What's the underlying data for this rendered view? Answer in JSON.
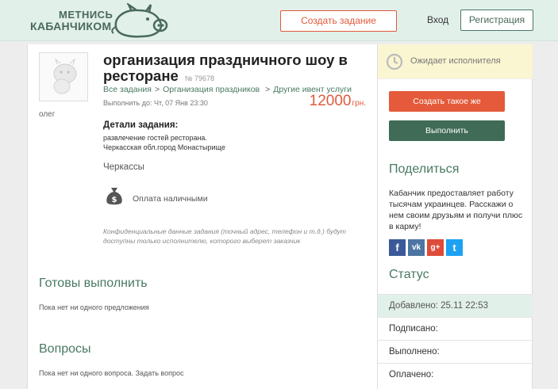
{
  "header": {
    "logo_line1": "МЕТНИСЬ",
    "logo_line2": "КАБАНЧИКОМ",
    "create_task_label": "Создать задание",
    "login_label": "Вход",
    "register_label": "Регистрация"
  },
  "task": {
    "user": "олег",
    "title": "организация праздничного шоу в ресторане",
    "number": "№ 79678",
    "breadcrumbs": [
      "Все задания",
      "Организация праздников",
      "Другие ивент услуги"
    ],
    "deadline": "Выполнить до: Чт, 07 Янв 23:30",
    "price": "12000",
    "price_unit": "грн.",
    "details_title": "Детали задания:",
    "details_line1": "развлечение гостей ресторана.",
    "details_line2": "Черкасская обл.город Монастырище",
    "city": "Черкассы",
    "payment": "Оплата наличными",
    "confidential": "Конфиденциальные данные задания (точный адрес, телефон и т.д.) будут доступны только исполнителю, которого выберет заказчик"
  },
  "offers": {
    "title": "Готовы выполнить",
    "empty": "Пока нет ни одного предложения"
  },
  "questions": {
    "title": "Вопросы",
    "empty": "Пока нет ни одного вопроса. Задать вопрос"
  },
  "sidebar": {
    "waiting": "Ожидает исполнителя",
    "similar_label": "Создать такое же",
    "perform_label": "Выполнить",
    "share_title": "Поделиться",
    "share_text": "Кабанчик предоставляет работу тысячам украинцев. Расскажи о нем своим друзьям и получи плюс в карму!",
    "social": [
      {
        "name": "facebook",
        "glyph": "f",
        "color": "#3b5998"
      },
      {
        "name": "vkontakte",
        "glyph": "vk",
        "color": "#4c75a3"
      },
      {
        "name": "google-plus",
        "glyph": "g+",
        "color": "#dd4b39"
      },
      {
        "name": "twitter",
        "glyph": "t",
        "color": "#1da1f2"
      }
    ],
    "status_title": "Статус",
    "status_rows": [
      "Добавлено: 25.11 22:53",
      "Подписано:",
      "Выполнено:",
      "Оплачено:"
    ]
  },
  "colors": {
    "accent_green": "#4a7a62",
    "accent_red": "#e05a3c",
    "header_bg": "#e2f0ea"
  }
}
